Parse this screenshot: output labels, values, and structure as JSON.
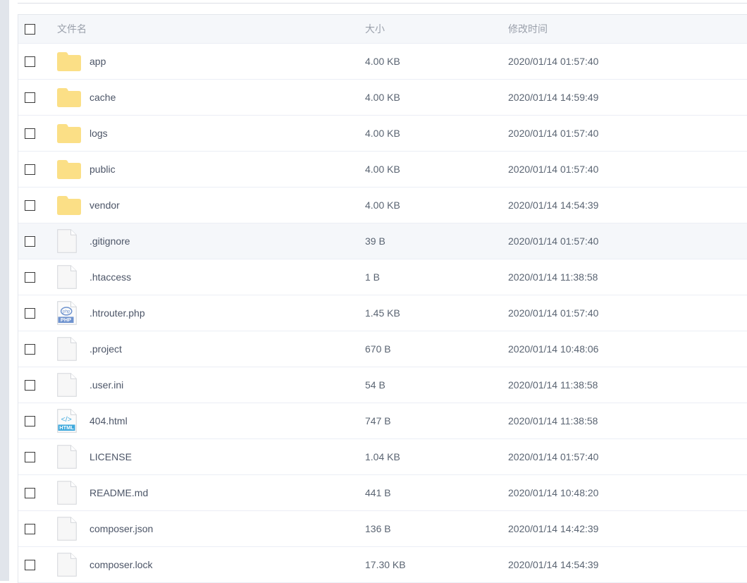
{
  "table": {
    "columns": {
      "select_all_label": "",
      "name": "文件名",
      "size": "大小",
      "mtime": "修改时间"
    },
    "rows": [
      {
        "icon": "folder-icon",
        "name": "app",
        "size": "4.00 KB",
        "mtime": "2020/01/14 01:57:40",
        "highlight": false
      },
      {
        "icon": "folder-icon",
        "name": "cache",
        "size": "4.00 KB",
        "mtime": "2020/01/14 14:59:49",
        "highlight": false
      },
      {
        "icon": "folder-icon",
        "name": "logs",
        "size": "4.00 KB",
        "mtime": "2020/01/14 01:57:40",
        "highlight": false
      },
      {
        "icon": "folder-icon",
        "name": "public",
        "size": "4.00 KB",
        "mtime": "2020/01/14 01:57:40",
        "highlight": false
      },
      {
        "icon": "folder-icon",
        "name": "vendor",
        "size": "4.00 KB",
        "mtime": "2020/01/14 14:54:39",
        "highlight": false
      },
      {
        "icon": "file-icon",
        "name": ".gitignore",
        "size": "39 B",
        "mtime": "2020/01/14 01:57:40",
        "highlight": true
      },
      {
        "icon": "file-icon",
        "name": ".htaccess",
        "size": "1 B",
        "mtime": "2020/01/14 11:38:58",
        "highlight": false
      },
      {
        "icon": "php-file-icon",
        "name": ".htrouter.php",
        "size": "1.45 KB",
        "mtime": "2020/01/14 01:57:40",
        "highlight": false
      },
      {
        "icon": "file-icon",
        "name": ".project",
        "size": "670 B",
        "mtime": "2020/01/14 10:48:06",
        "highlight": false
      },
      {
        "icon": "file-icon",
        "name": ".user.ini",
        "size": "54 B",
        "mtime": "2020/01/14 11:38:58",
        "highlight": false
      },
      {
        "icon": "html-file-icon",
        "name": "404.html",
        "size": "747 B",
        "mtime": "2020/01/14 11:38:58",
        "highlight": false
      },
      {
        "icon": "file-icon",
        "name": "LICENSE",
        "size": "1.04 KB",
        "mtime": "2020/01/14 01:57:40",
        "highlight": false
      },
      {
        "icon": "file-icon",
        "name": "README.md",
        "size": "441 B",
        "mtime": "2020/01/14 10:48:20",
        "highlight": false
      },
      {
        "icon": "file-icon",
        "name": "composer.json",
        "size": "136 B",
        "mtime": "2020/01/14 14:42:39",
        "highlight": false
      },
      {
        "icon": "file-icon",
        "name": "composer.lock",
        "size": "17.30 KB",
        "mtime": "2020/01/14 14:54:39",
        "highlight": false
      }
    ]
  },
  "colors": {
    "folder": "#fbdf86",
    "php_badge": "#6f93cf",
    "html_badge": "#3fa9dd",
    "header_bg": "#f5f7fa",
    "row_border": "#ebeef5",
    "text": "#5a6472"
  },
  "icon_labels": {
    "php": "PHP",
    "html": "HTML"
  }
}
